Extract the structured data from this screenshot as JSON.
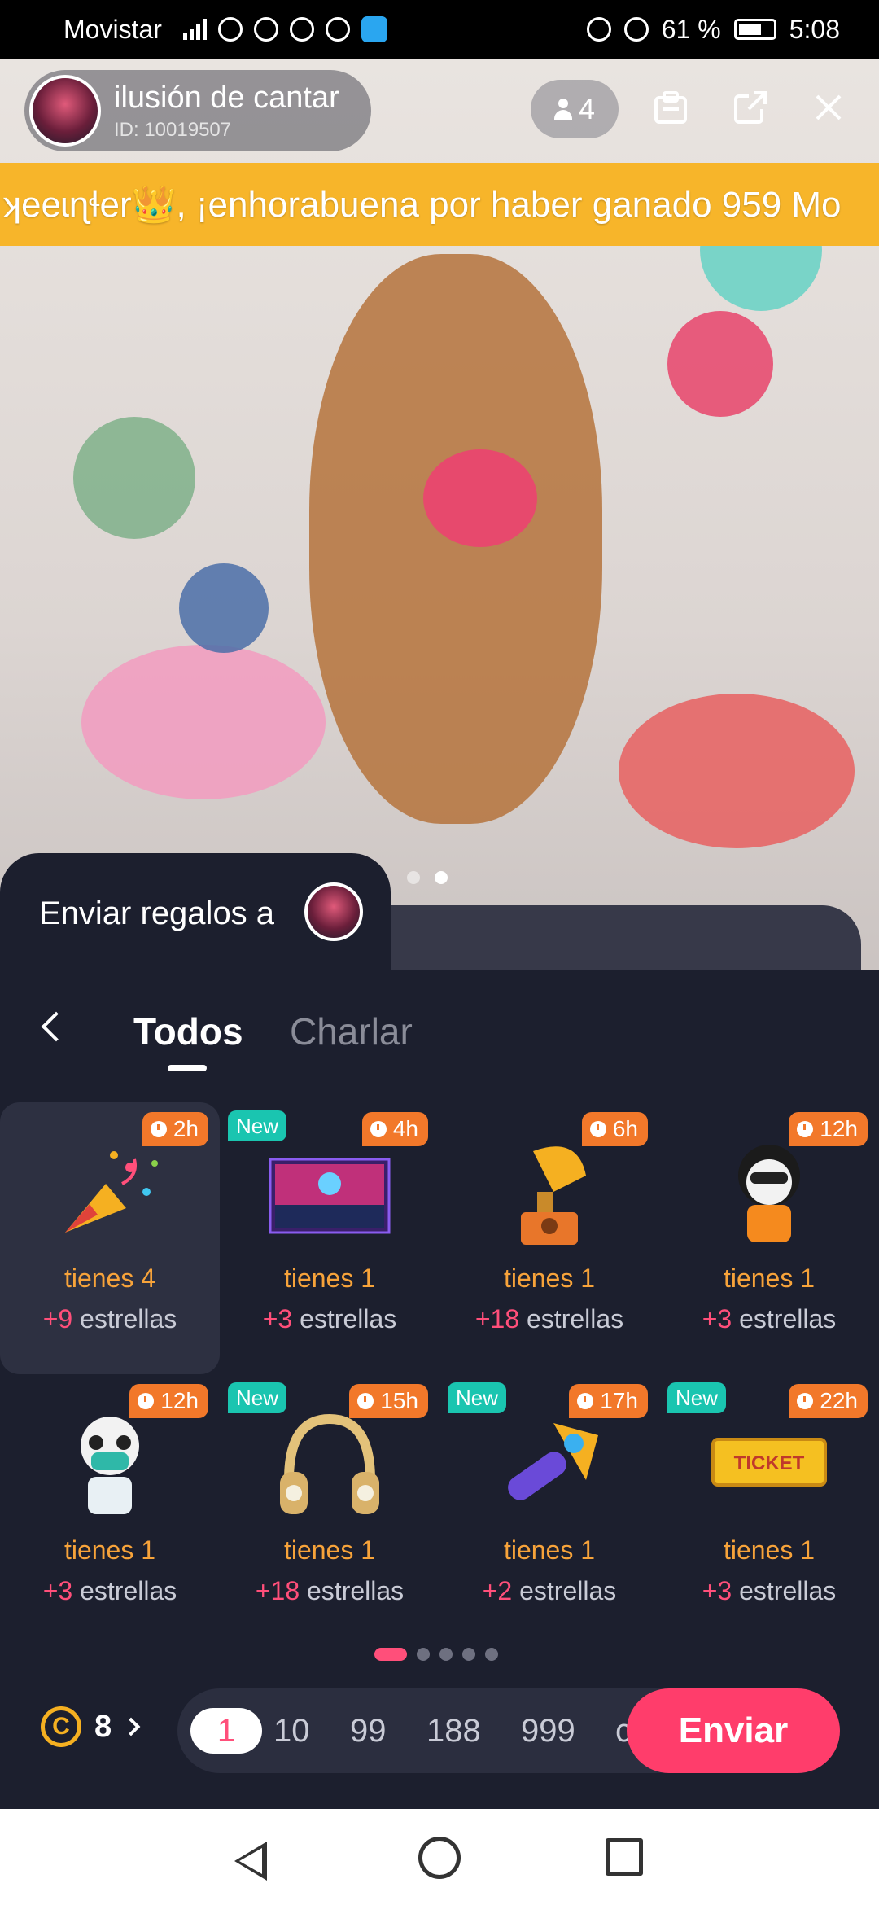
{
  "status_bar": {
    "carrier": "Movistar",
    "battery_text": "61 %",
    "time": "5:08"
  },
  "room": {
    "name": "ilusión de cantar",
    "id_text": "ID: 10019507",
    "member_count": "4"
  },
  "marquee": {
    "text": "ʞeeɩɳɬer👑, ¡enhorabuena por haber ganado 959 Mo"
  },
  "gift_sheet": {
    "title": "Enviar regalos a",
    "tabs": [
      {
        "label": "Todos",
        "active": true
      },
      {
        "label": "Charlar",
        "active": false
      }
    ],
    "gifts": [
      {
        "badge_new": "",
        "time": "2h",
        "have": "tienes 4",
        "stars_num": "+9",
        "stars_text": "estrellas",
        "icon": "party-popper-icon",
        "selected": true
      },
      {
        "badge_new": "New",
        "time": "4h",
        "have": "tienes 1",
        "stars_num": "+3",
        "stars_text": "estrellas",
        "icon": "dj-stage-icon",
        "selected": false
      },
      {
        "badge_new": "",
        "time": "6h",
        "have": "tienes 1",
        "stars_num": "+18",
        "stars_text": "estrellas",
        "icon": "gramophone-icon",
        "selected": false
      },
      {
        "badge_new": "",
        "time": "12h",
        "have": "tienes 1",
        "stars_num": "+3",
        "stars_text": "estrellas",
        "icon": "panda-rapper-icon",
        "selected": false
      },
      {
        "badge_new": "",
        "time": "12h",
        "have": "tienes 1",
        "stars_num": "+3",
        "stars_text": "estrellas",
        "icon": "panda-doctor-icon",
        "selected": false
      },
      {
        "badge_new": "New",
        "time": "15h",
        "have": "tienes 1",
        "stars_num": "+18",
        "stars_text": "estrellas",
        "icon": "headphones-icon",
        "selected": false
      },
      {
        "badge_new": "New",
        "time": "17h",
        "have": "tienes 1",
        "stars_num": "+2",
        "stars_text": "estrellas",
        "icon": "magic-hammer-icon",
        "selected": false
      },
      {
        "badge_new": "New",
        "time": "22h",
        "have": "tienes 1",
        "stars_num": "+3",
        "stars_text": "estrellas",
        "icon": "ticket-icon",
        "selected": false
      }
    ],
    "ticket_text": "TICKET",
    "page_index": 1,
    "page_count": 5
  },
  "footer": {
    "coin_symbol": "C",
    "coin_count": "8",
    "quantities": [
      "1",
      "10",
      "99",
      "188",
      "999",
      "c"
    ],
    "selected_quantity": "1",
    "send_label": "Enviar"
  },
  "colors": {
    "sheet_bg": "#1c1f2e",
    "accent_pink": "#ff3d6b",
    "badge_orange": "#f2782a",
    "badge_new": "#1ac5b0",
    "gift_count_orange": "#f7a33a",
    "marquee_bg": "#f7b52a"
  }
}
